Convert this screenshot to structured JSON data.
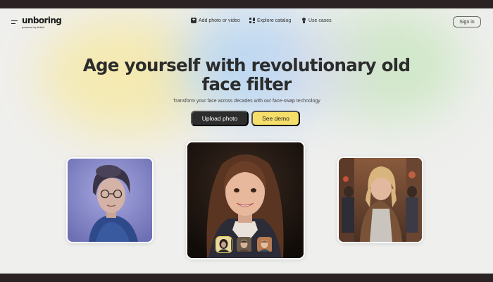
{
  "header": {
    "logo_name": "unboring",
    "logo_sub": "powered by Artbot",
    "nav": [
      {
        "label": "Add photo or video",
        "icon": "add-icon"
      },
      {
        "label": "Explore catalog",
        "icon": "grid-icon"
      },
      {
        "label": "Use cases",
        "icon": "bulb-icon"
      }
    ],
    "signin_label": "Sign in"
  },
  "hero": {
    "title_line1": "Age yourself with revolutionary old",
    "title_line2": "face filter",
    "subtitle": "Transform your face across decades with our face-swap technology",
    "upload_label": "Upload photo",
    "demo_label": "See demo"
  },
  "gallery": {
    "images": [
      "elderly-woman-portrait",
      "young-girl-portrait",
      "little-girl-street-photo"
    ],
    "thumbnails": [
      "face-variant-1",
      "face-variant-2",
      "face-variant-3"
    ],
    "active_thumbnail": 1
  },
  "colors": {
    "accent_yellow": "#f6de6a",
    "dark_button": "#2d2d2d",
    "page_background": "#efefee",
    "frame": "#2b2323"
  }
}
